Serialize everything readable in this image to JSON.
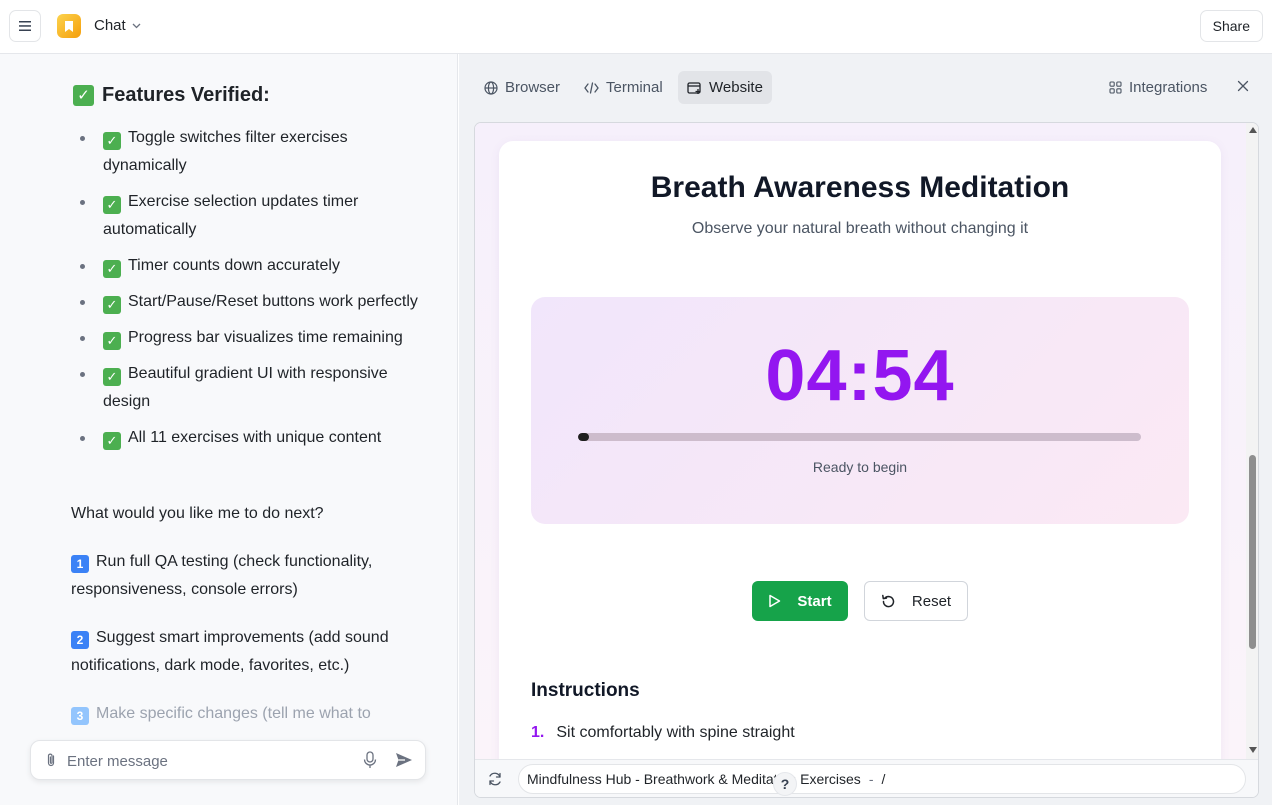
{
  "header": {
    "title": "Chat",
    "share_label": "Share"
  },
  "chat": {
    "features_heading": "Features Verified:",
    "features": [
      "Toggle switches filter exercises dynamically",
      "Exercise selection updates timer automatically",
      "Timer counts down accurately",
      "Start/Pause/Reset buttons work perfectly",
      "Progress bar visualizes time remaining",
      "Beautiful gradient UI with responsive design",
      "All 11 exercises with unique content"
    ],
    "question": "What would you like me to do next?",
    "options": [
      {
        "num": "1",
        "text": "Run full QA testing (check functionality, responsiveness, console errors)"
      },
      {
        "num": "2",
        "text": "Suggest smart improvements (add sound notifications, dark mode, favorites, etc.)"
      },
      {
        "num": "3",
        "text": "Make specific changes (tell me what to"
      }
    ],
    "input_placeholder": "Enter message"
  },
  "panel": {
    "tabs": [
      {
        "label": "Browser"
      },
      {
        "label": "Terminal"
      },
      {
        "label": "Website"
      }
    ],
    "active_tab": "Website",
    "integrations_label": "Integrations"
  },
  "website": {
    "title": "Breath Awareness Meditation",
    "subtitle": "Observe your natural breath without changing it",
    "timer": "04:54",
    "progress_fraction": 0.02,
    "status": "Ready to begin",
    "start_label": "Start",
    "reset_label": "Reset",
    "instructions_heading": "Instructions",
    "instructions": [
      {
        "num": "1.",
        "text": "Sit comfortably with spine straight"
      }
    ]
  },
  "address": {
    "page_title": "Mindfulness Hub - Breathwork & Meditation Exercises",
    "separator": "-",
    "path": "/"
  },
  "help_label": "?",
  "colors": {
    "accent_purple": "#9316f0",
    "start_green": "#16a34a",
    "check_green": "#4caf50",
    "number_blue": "#3b82f6"
  }
}
